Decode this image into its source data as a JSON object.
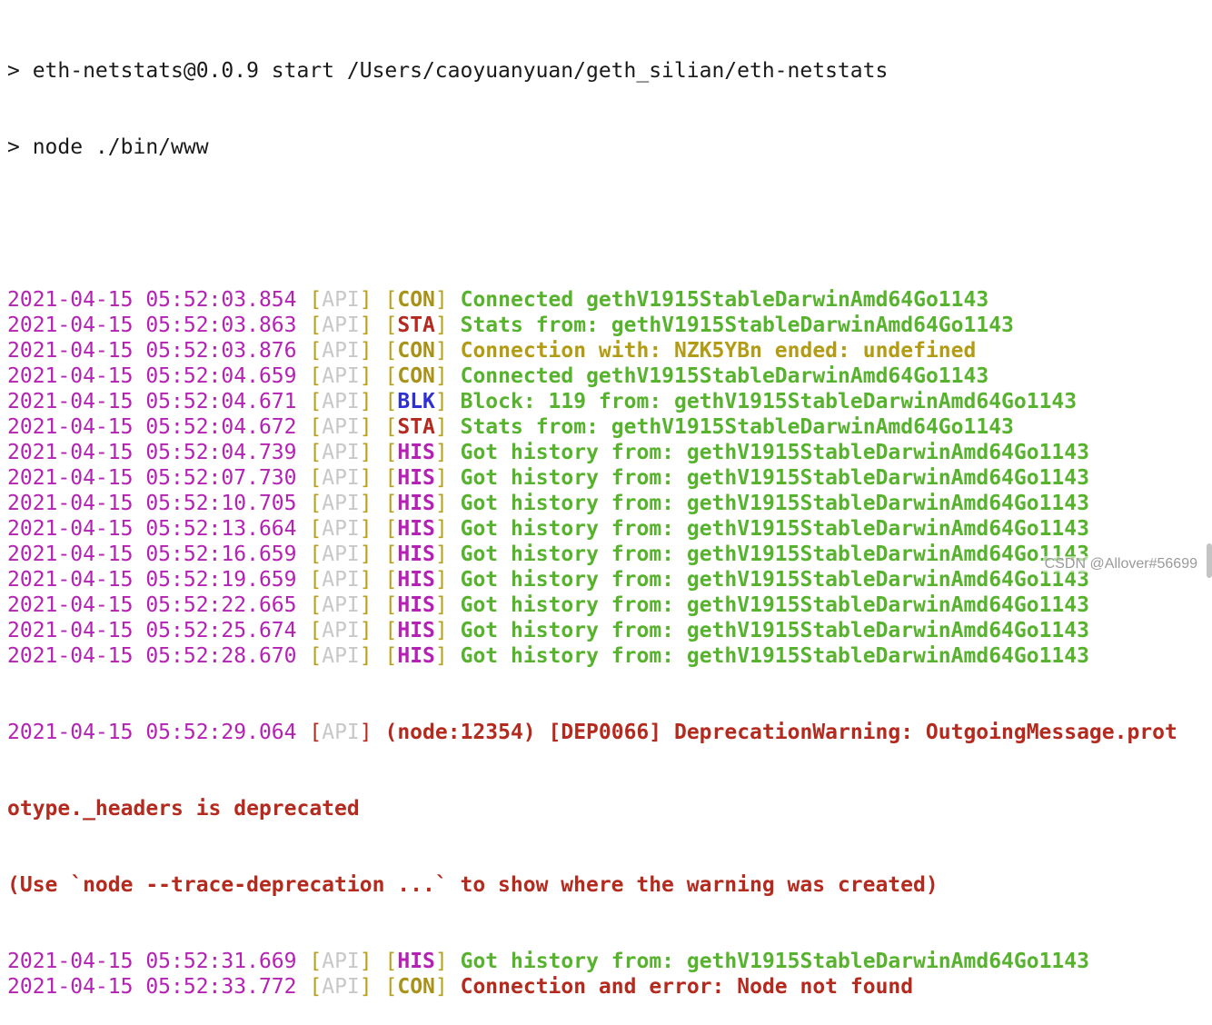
{
  "terminal": {
    "header": [
      "> eth-netstats@0.0.9 start /Users/caoyuanyuan/geth_silian/eth-netstats",
      "> node ./bin/www"
    ],
    "api_label": "API",
    "logs": [
      {
        "ts": "2021-04-15 05:52:03.854",
        "tag": "CON",
        "msg": "Connected gethV1915StableDarwinAmd64Go1143",
        "msg_color": "green"
      },
      {
        "ts": "2021-04-15 05:52:03.863",
        "tag": "STA",
        "msg": "Stats from: gethV1915StableDarwinAmd64Go1143",
        "msg_color": "green"
      },
      {
        "ts": "2021-04-15 05:52:03.876",
        "tag": "CON",
        "msg": "Connection with: NZK5YBn ended: undefined",
        "msg_color": "yellow"
      },
      {
        "ts": "2021-04-15 05:52:04.659",
        "tag": "CON",
        "msg": "Connected gethV1915StableDarwinAmd64Go1143",
        "msg_color": "green"
      },
      {
        "ts": "2021-04-15 05:52:04.671",
        "tag": "BLK",
        "msg": "Block: 119 from: gethV1915StableDarwinAmd64Go1143",
        "msg_color": "green"
      },
      {
        "ts": "2021-04-15 05:52:04.672",
        "tag": "STA",
        "msg": "Stats from: gethV1915StableDarwinAmd64Go1143",
        "msg_color": "green"
      },
      {
        "ts": "2021-04-15 05:52:04.739",
        "tag": "HIS",
        "msg": "Got history from: gethV1915StableDarwinAmd64Go1143",
        "msg_color": "green"
      },
      {
        "ts": "2021-04-15 05:52:07.730",
        "tag": "HIS",
        "msg": "Got history from: gethV1915StableDarwinAmd64Go1143",
        "msg_color": "green"
      },
      {
        "ts": "2021-04-15 05:52:10.705",
        "tag": "HIS",
        "msg": "Got history from: gethV1915StableDarwinAmd64Go1143",
        "msg_color": "green"
      },
      {
        "ts": "2021-04-15 05:52:13.664",
        "tag": "HIS",
        "msg": "Got history from: gethV1915StableDarwinAmd64Go1143",
        "msg_color": "green"
      },
      {
        "ts": "2021-04-15 05:52:16.659",
        "tag": "HIS",
        "msg": "Got history from: gethV1915StableDarwinAmd64Go1143",
        "msg_color": "green"
      },
      {
        "ts": "2021-04-15 05:52:19.659",
        "tag": "HIS",
        "msg": "Got history from: gethV1915StableDarwinAmd64Go1143",
        "msg_color": "green"
      },
      {
        "ts": "2021-04-15 05:52:22.665",
        "tag": "HIS",
        "msg": "Got history from: gethV1915StableDarwinAmd64Go1143",
        "msg_color": "green"
      },
      {
        "ts": "2021-04-15 05:52:25.674",
        "tag": "HIS",
        "msg": "Got history from: gethV1915StableDarwinAmd64Go1143",
        "msg_color": "green"
      },
      {
        "ts": "2021-04-15 05:52:28.670",
        "tag": "HIS",
        "msg": "Got history from: gethV1915StableDarwinAmd64Go1143",
        "msg_color": "green"
      }
    ],
    "deprecation": {
      "ts": "2021-04-15 05:52:29.064",
      "line1": "(node:12354) [DEP0066] DeprecationWarning: OutgoingMessage.prot",
      "line2": "otype._headers is deprecated",
      "line3": "(Use `node --trace-deprecation ...` to show where the warning was created)"
    },
    "after_logs": [
      {
        "ts": "2021-04-15 05:52:31.669",
        "tag": "HIS",
        "msg": "Got history from: gethV1915StableDarwinAmd64Go1143",
        "msg_color": "green"
      },
      {
        "ts": "2021-04-15 05:52:33.772",
        "tag": "CON",
        "msg": "Connection and error: Node not found",
        "msg_color": "red"
      }
    ]
  },
  "watermark": "CSDN @Allover#56699",
  "colors": {
    "timestamp": "#b421b4",
    "bracket": "#b8a11c",
    "api": "#c8c8c8",
    "green": "#57b32d",
    "yellow": "#b39b14",
    "red": "#b52a1e",
    "blue": "#2e30d0"
  }
}
